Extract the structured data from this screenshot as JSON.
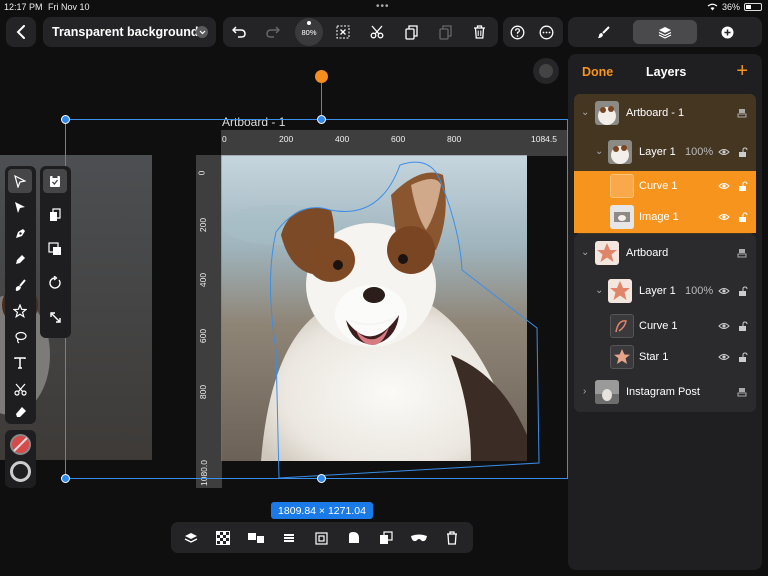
{
  "status": {
    "time": "12:17 PM",
    "date": "Fri Nov 10",
    "dots": "•••",
    "battery": "36%"
  },
  "header": {
    "title": "Transparent background",
    "zoom": "80%"
  },
  "canvas": {
    "artboard_label": "Artboard - 1",
    "ruler_h": [
      "0",
      "200",
      "400",
      "600",
      "800",
      "1084.5"
    ],
    "ruler_v": [
      "0",
      "200",
      "400",
      "600",
      "800",
      "1080.0"
    ],
    "dimensions": "1809.84 × 1271.04"
  },
  "panel": {
    "done": "Done",
    "title": "Layers",
    "add": "+",
    "rows": [
      {
        "name": "Artboard - 1"
      },
      {
        "name": "Layer 1",
        "opacity": "100%"
      },
      {
        "name": "Curve 1"
      },
      {
        "name": "Image 1"
      },
      {
        "name": "Artboard"
      },
      {
        "name": "Layer 1",
        "opacity": "100%"
      },
      {
        "name": "Curve 1"
      },
      {
        "name": "Star 1"
      },
      {
        "name": "Instagram Post"
      }
    ]
  },
  "colors": {
    "accent": "#f7941d",
    "selection": "#2e8cf0",
    "panel": "#1f1f21"
  }
}
